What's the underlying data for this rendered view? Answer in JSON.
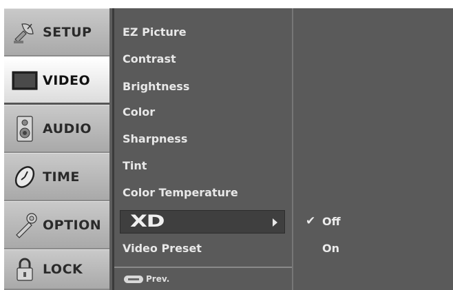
{
  "categories": [
    {
      "label": "SETUP",
      "icon": "satellite-icon",
      "active": false
    },
    {
      "label": "VIDEO",
      "icon": "screen-icon",
      "active": true
    },
    {
      "label": "AUDIO",
      "icon": "speaker-icon",
      "active": false
    },
    {
      "label": "TIME",
      "icon": "clock-icon",
      "active": false
    },
    {
      "label": "OPTION",
      "icon": "wrench-icon",
      "active": false
    },
    {
      "label": "LOCK",
      "icon": "padlock-icon",
      "active": false
    }
  ],
  "video_menu": {
    "items": [
      "EZ Picture",
      "Contrast",
      "Brightness",
      "Color",
      "Sharpness",
      "Tint",
      "Color Temperature",
      "XD",
      "Video Preset"
    ],
    "selected_item": "XD",
    "prev_label": "Prev."
  },
  "xd_options": {
    "items": [
      "Off",
      "On"
    ],
    "selected": "Off"
  },
  "colors": {
    "menu_bg": "#5a5a5a",
    "tab_bg": "#b5b5b5",
    "active_tab_bg": "#f0f0f0",
    "selected_row_bg": "#3f3f3f",
    "text": "#e8e8e8"
  }
}
